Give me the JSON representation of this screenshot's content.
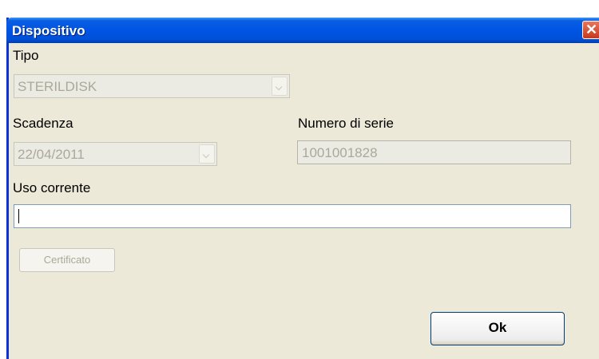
{
  "window": {
    "title": "Dispositivo",
    "close_label": "✕"
  },
  "tipo": {
    "label": "Tipo",
    "value": "STERILDISK"
  },
  "scadenza": {
    "label": "Scadenza",
    "value": "22/04/2011"
  },
  "numero_serie": {
    "label": "Numero di serie",
    "value": "1001001828"
  },
  "uso_corrente": {
    "label": "Uso corrente",
    "value": ""
  },
  "buttons": {
    "certificato": "Certificato",
    "ok": "Ok"
  }
}
